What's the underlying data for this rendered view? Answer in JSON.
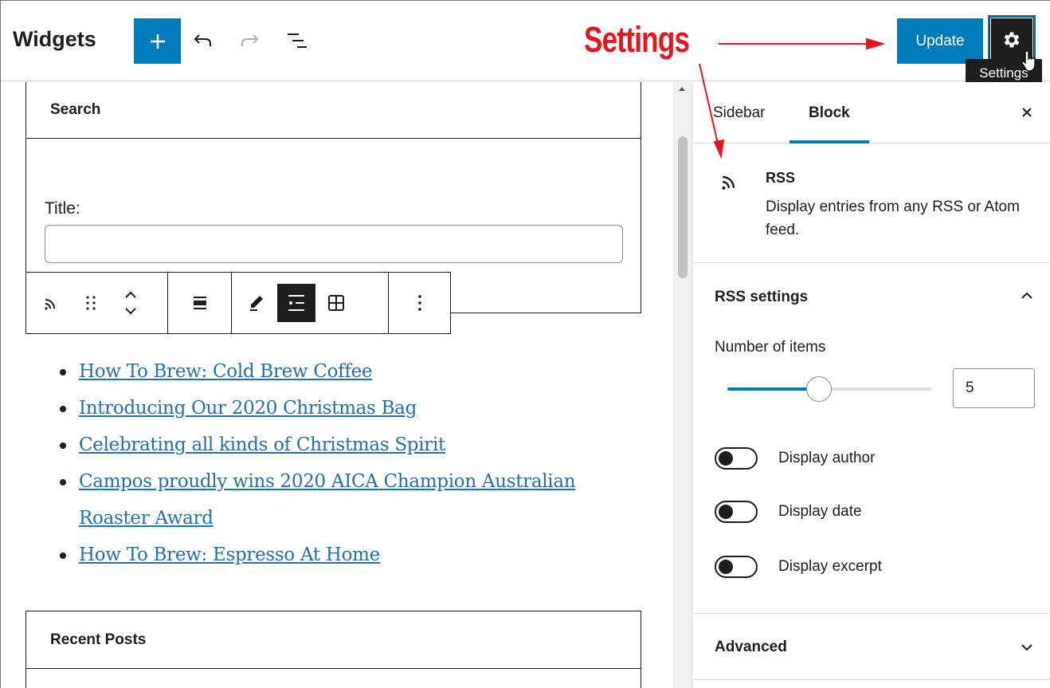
{
  "header": {
    "title": "Widgets",
    "add_label": "+",
    "update_label": "Update",
    "settings_tooltip": "Settings",
    "icons": [
      "plus-icon",
      "undo-icon",
      "redo-icon",
      "list-view-icon",
      "gear-icon"
    ]
  },
  "annotation": {
    "label": "Settings",
    "color": "#e8141e"
  },
  "canvas": {
    "search_widget": {
      "heading": "Search",
      "field_label": "Title:",
      "field_value": ""
    },
    "toolbar_icons": [
      "rss-icon",
      "drag-handle-icon",
      "move-up-down-icon",
      "align-icon",
      "edit-icon",
      "list-view-icon",
      "grid-view-icon",
      "more-options-icon"
    ],
    "rss_items": [
      "How To Brew: Cold Brew Coffee",
      "Introducing Our 2020 Christmas Bag",
      "Celebrating all kinds of Christmas Spirit",
      "Campos proudly wins 2020 AICA Champion Australian Roaster Award",
      "How To Brew: Espresso At Home"
    ],
    "recent_posts_widget": {
      "heading": "Recent Posts"
    }
  },
  "sidebar": {
    "tabs": [
      "Sidebar",
      "Block"
    ],
    "active_tab": "Block",
    "block": {
      "name": "RSS",
      "description": "Display entries from any RSS or Atom feed."
    },
    "rss_settings": {
      "title": "RSS settings",
      "number_label": "Number of items",
      "number_value": "5",
      "range_fraction": 0.45,
      "toggles": [
        {
          "label": "Display author",
          "on": false
        },
        {
          "label": "Display date",
          "on": false
        },
        {
          "label": "Display excerpt",
          "on": false
        }
      ]
    },
    "advanced": {
      "title": "Advanced"
    }
  },
  "colors": {
    "accent": "#007cba",
    "link": "#2271b1",
    "dark": "#1e1e1e"
  }
}
